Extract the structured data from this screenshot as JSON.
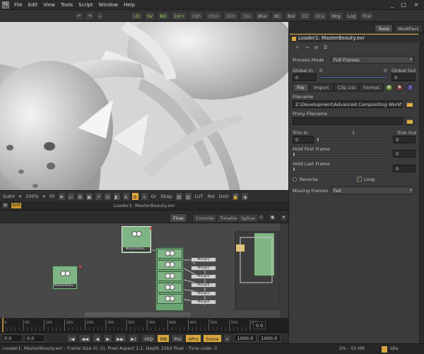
{
  "menu": [
    "File",
    "Edit",
    "View",
    "Tools",
    "Script",
    "Window",
    "Help"
  ],
  "app_badge": "F6",
  "window_controls": [
    "_",
    "□",
    "×"
  ],
  "toolbar": {
    "left": [
      "↶",
      "↷",
      "▹"
    ],
    "items": [
      "LD",
      "SV",
      "BG",
      "1st+",
      "CBh",
      "3Dm",
      "3Dh",
      "3SL",
      "Blur",
      "BC",
      "Bol",
      "CC",
      "CCv",
      "Mrg",
      "Log",
      "FLU"
    ]
  },
  "viewer": {
    "bar": [
      "SubV",
      "▾",
      "100%",
      "▾",
      "Fit",
      "A",
      "B",
      "Gr",
      "Shap",
      "LUT",
      "Rol",
      "DoD"
    ],
    "title": "Loader1: MasterBeauty.exr",
    "left_buttons": [
      "⊞",
      "SnR"
    ]
  },
  "flow": {
    "tabs": [
      "Flow",
      "Console",
      "Timeline",
      "Spline"
    ],
    "nodes": [
      {
        "label": "MasterBeau..."
      },
      {
        "label": "MasterBeau..."
      },
      {
        "label": "..."
      },
      {
        "label": "..."
      },
      {
        "label": "..."
      },
      {
        "label": "..."
      },
      {
        "label": "..."
      }
    ],
    "merges": [
      "Merge1",
      "Merge2",
      "Merge3",
      "Merge4",
      "Merge5",
      "Merge6"
    ]
  },
  "timeline": {
    "ruler_labels": [
      "0",
      "50",
      "100",
      "150",
      "200",
      "250",
      "300",
      "350",
      "400",
      "450",
      "500",
      "550",
      "600"
    ],
    "current_value": "0.0",
    "transport": {
      "start": "0.0",
      "start2": "0.0",
      "buttons": [
        "|◀",
        "◀◀",
        "◀",
        "▶",
        "▶▶",
        "▶|"
      ],
      "hiq": "HiQ",
      "mb": "MB",
      "prx": "Prx",
      "aprx": "APrx",
      "some": "Some",
      "arrows": "»",
      "end1": "1000.0",
      "end2": "1000.0"
    }
  },
  "status": {
    "left": "Loader1: MasterBeauty.exr - Frame Size (0, 0), Pixel Aspect 1:1, Depth 32bit float - Time code: 0",
    "mem": "2% - 50 MB",
    "state": "Idle"
  },
  "right_panel": {
    "tabs": [
      "Tools",
      "Modifiers"
    ],
    "tool_title": "Loader1: MasterBeauty.exr",
    "process_mode_label": "Process Mode",
    "process_mode_value": "Full Frames",
    "global_in_label": "Global In",
    "global_out_label": "Global Out",
    "global_in_value": "0",
    "global_slider_left": "0",
    "global_slider_right": "0",
    "global_out_value": "0",
    "param_tabs": [
      "File",
      "Import",
      "Clip List",
      "Format"
    ],
    "filename_label": "Filename",
    "filename_value": "Z:\\Development\\Advanced Compositing Workflo",
    "proxy_label": "Proxy Filename",
    "proxy_value": "",
    "trim_in_label": "Trim In",
    "trim_out_label": "Trim Out",
    "trim_mid": "1",
    "trim_in_value": "0",
    "trim_out_value": "0",
    "hold_first_label": "Hold First Frame",
    "hold_first_value": "0",
    "hold_last_label": "Hold Last Frame",
    "hold_last_value": "0",
    "reverse_label": "Reverse",
    "loop_label": "Loop",
    "missing_label": "Missing Frames",
    "missing_value": "Fail"
  },
  "colors": {
    "accent": "#e0a63b",
    "node_green": "#7fb585",
    "panel": "#3b3b3b"
  }
}
